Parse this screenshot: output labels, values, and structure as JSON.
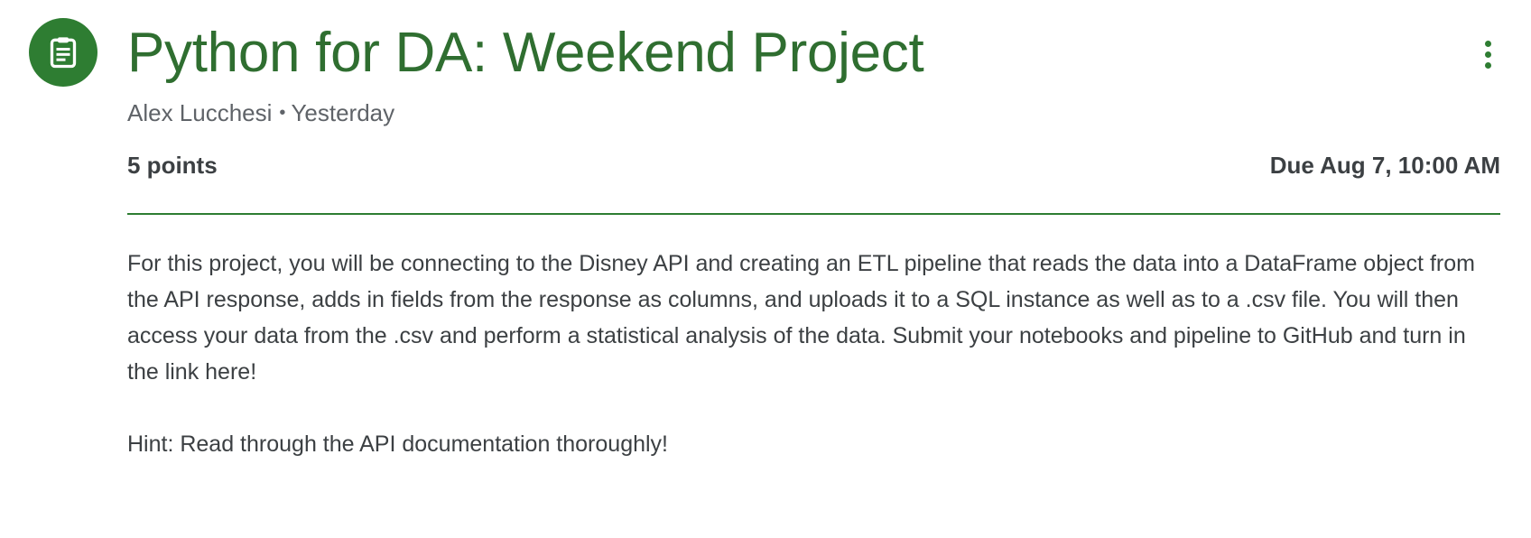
{
  "assignment": {
    "icon": "assignment-clipboard-icon",
    "title": "Python for DA: Weekend Project",
    "author": "Alex Lucchesi",
    "separator": "•",
    "posted": "Yesterday",
    "points": "5 points",
    "due": "Due Aug 7, 10:00 AM",
    "description": [
      "For this project, you will be connecting to the Disney API and creating an ETL pipeline that reads the data into a DataFrame object from the API response, adds in fields from the response as columns, and uploads it to a SQL instance as well as to a .csv file. You will then access your data from the .csv and perform a statistical analysis of the data. Submit your notebooks and pipeline to GitHub and turn in the link here!",
      "Hint: Read through the API documentation thoroughly!"
    ]
  },
  "more_menu": {
    "icon": "more-vertical-icon"
  },
  "colors": {
    "accent": "#2e7d32",
    "title": "#2f6e30",
    "meta_text": "#5f6368",
    "body_text": "#3c4043"
  }
}
